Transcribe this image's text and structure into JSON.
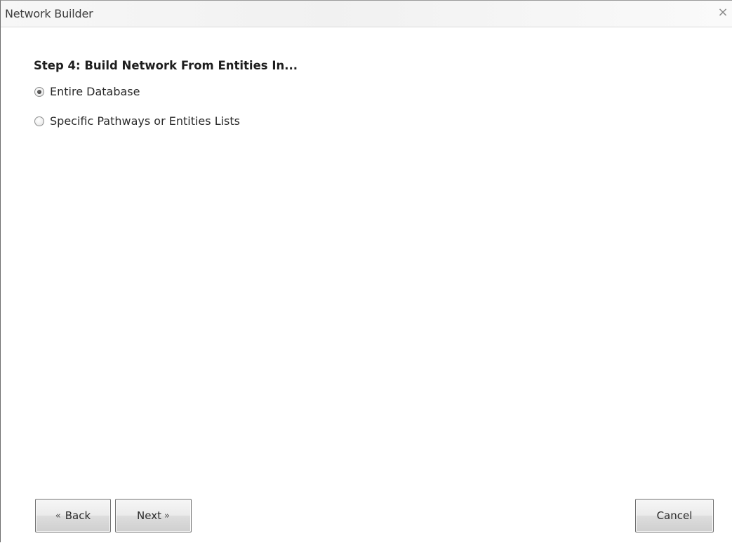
{
  "window": {
    "title": "Network Builder",
    "close_glyph": "×"
  },
  "step": {
    "heading": "Step 4: Build Network From Entities In..."
  },
  "options": [
    {
      "label": "Entire Database",
      "checked": true
    },
    {
      "label": "Specific Pathways or Entities Lists",
      "checked": false
    }
  ],
  "buttons": {
    "back": {
      "glyph": "«",
      "label": "Back"
    },
    "next": {
      "label": "Next",
      "glyph": "»"
    },
    "cancel": {
      "label": "Cancel"
    }
  },
  "icons": {
    "close": "close-icon"
  }
}
